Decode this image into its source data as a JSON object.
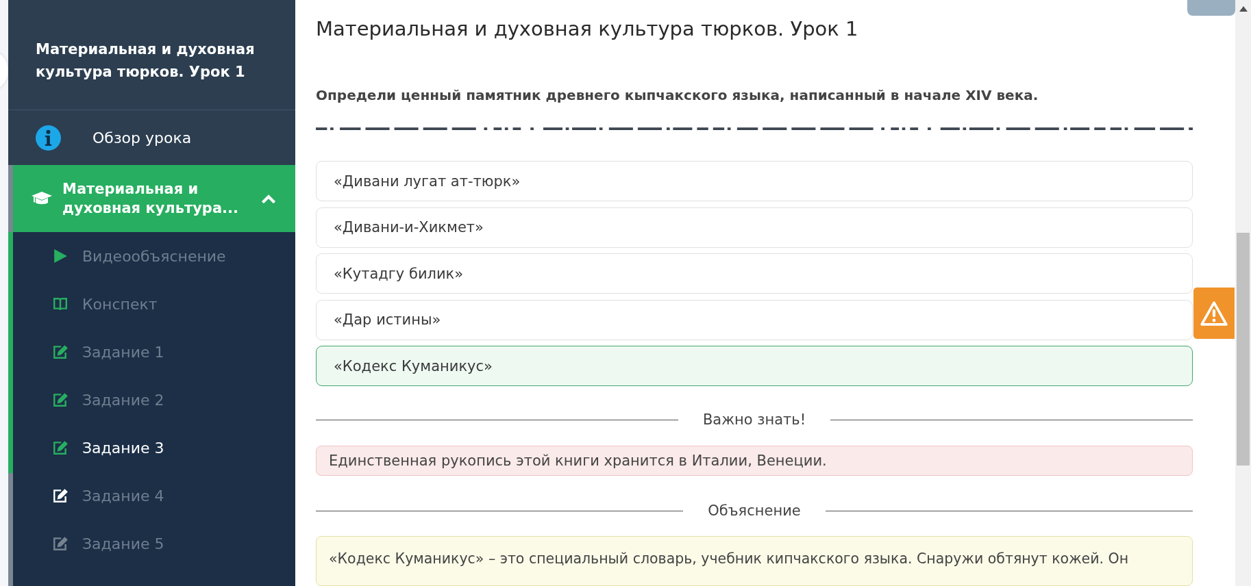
{
  "sidebar": {
    "course_title": "Материальная и духовная культура тюрков. Урок 1",
    "overview": {
      "label": "Обзор урока"
    },
    "section": {
      "label": "Материальная и духовная культура...",
      "expanded": true,
      "progress": {
        "level": 0.68
      }
    },
    "items": [
      {
        "label": "Видеообъяснение",
        "kind": "video",
        "completed": true,
        "locked": false,
        "selected": false
      },
      {
        "label": "Конспект",
        "kind": "notes",
        "completed": true,
        "locked": false,
        "selected": false
      },
      {
        "label": "Задание 1",
        "kind": "task",
        "completed": true,
        "locked": false,
        "selected": false
      },
      {
        "label": "Задание 2",
        "kind": "task",
        "completed": true,
        "locked": false,
        "selected": false
      },
      {
        "label": "Задание 3",
        "kind": "task",
        "completed": true,
        "locked": false,
        "selected": true
      },
      {
        "label": "Задание 4",
        "kind": "task",
        "completed": false,
        "locked": false,
        "selected": false
      },
      {
        "label": "Задание 5",
        "kind": "task",
        "completed": false,
        "locked": true,
        "selected": false
      }
    ]
  },
  "lesson": {
    "title": "Материальная и духовная культура тюрков. Урок 1",
    "question": "Определи ценный памятник древнего кыпчакского языка, написанный в начале XIV века.",
    "options": [
      {
        "text": "«Дивани лугат ат-тюрк»",
        "selected": false
      },
      {
        "text": "«Дивани-и-Хикмет»",
        "selected": false
      },
      {
        "text": "«Кутадгу билик»",
        "selected": false
      },
      {
        "text": "«Дар истины»",
        "selected": false
      },
      {
        "text": "«Кодекс Куманикус»",
        "selected": true
      }
    ],
    "note_heading": "Важно знать!",
    "note": "Единственная рукопись этой книги хранится в Италии, Венеции.",
    "explanation_heading": "Объяснение",
    "explanation": "«Кодекс Куманикус» – это специальный словарь, учебник кипчакского языка. Снаружи обтянут кожей. Он"
  }
}
